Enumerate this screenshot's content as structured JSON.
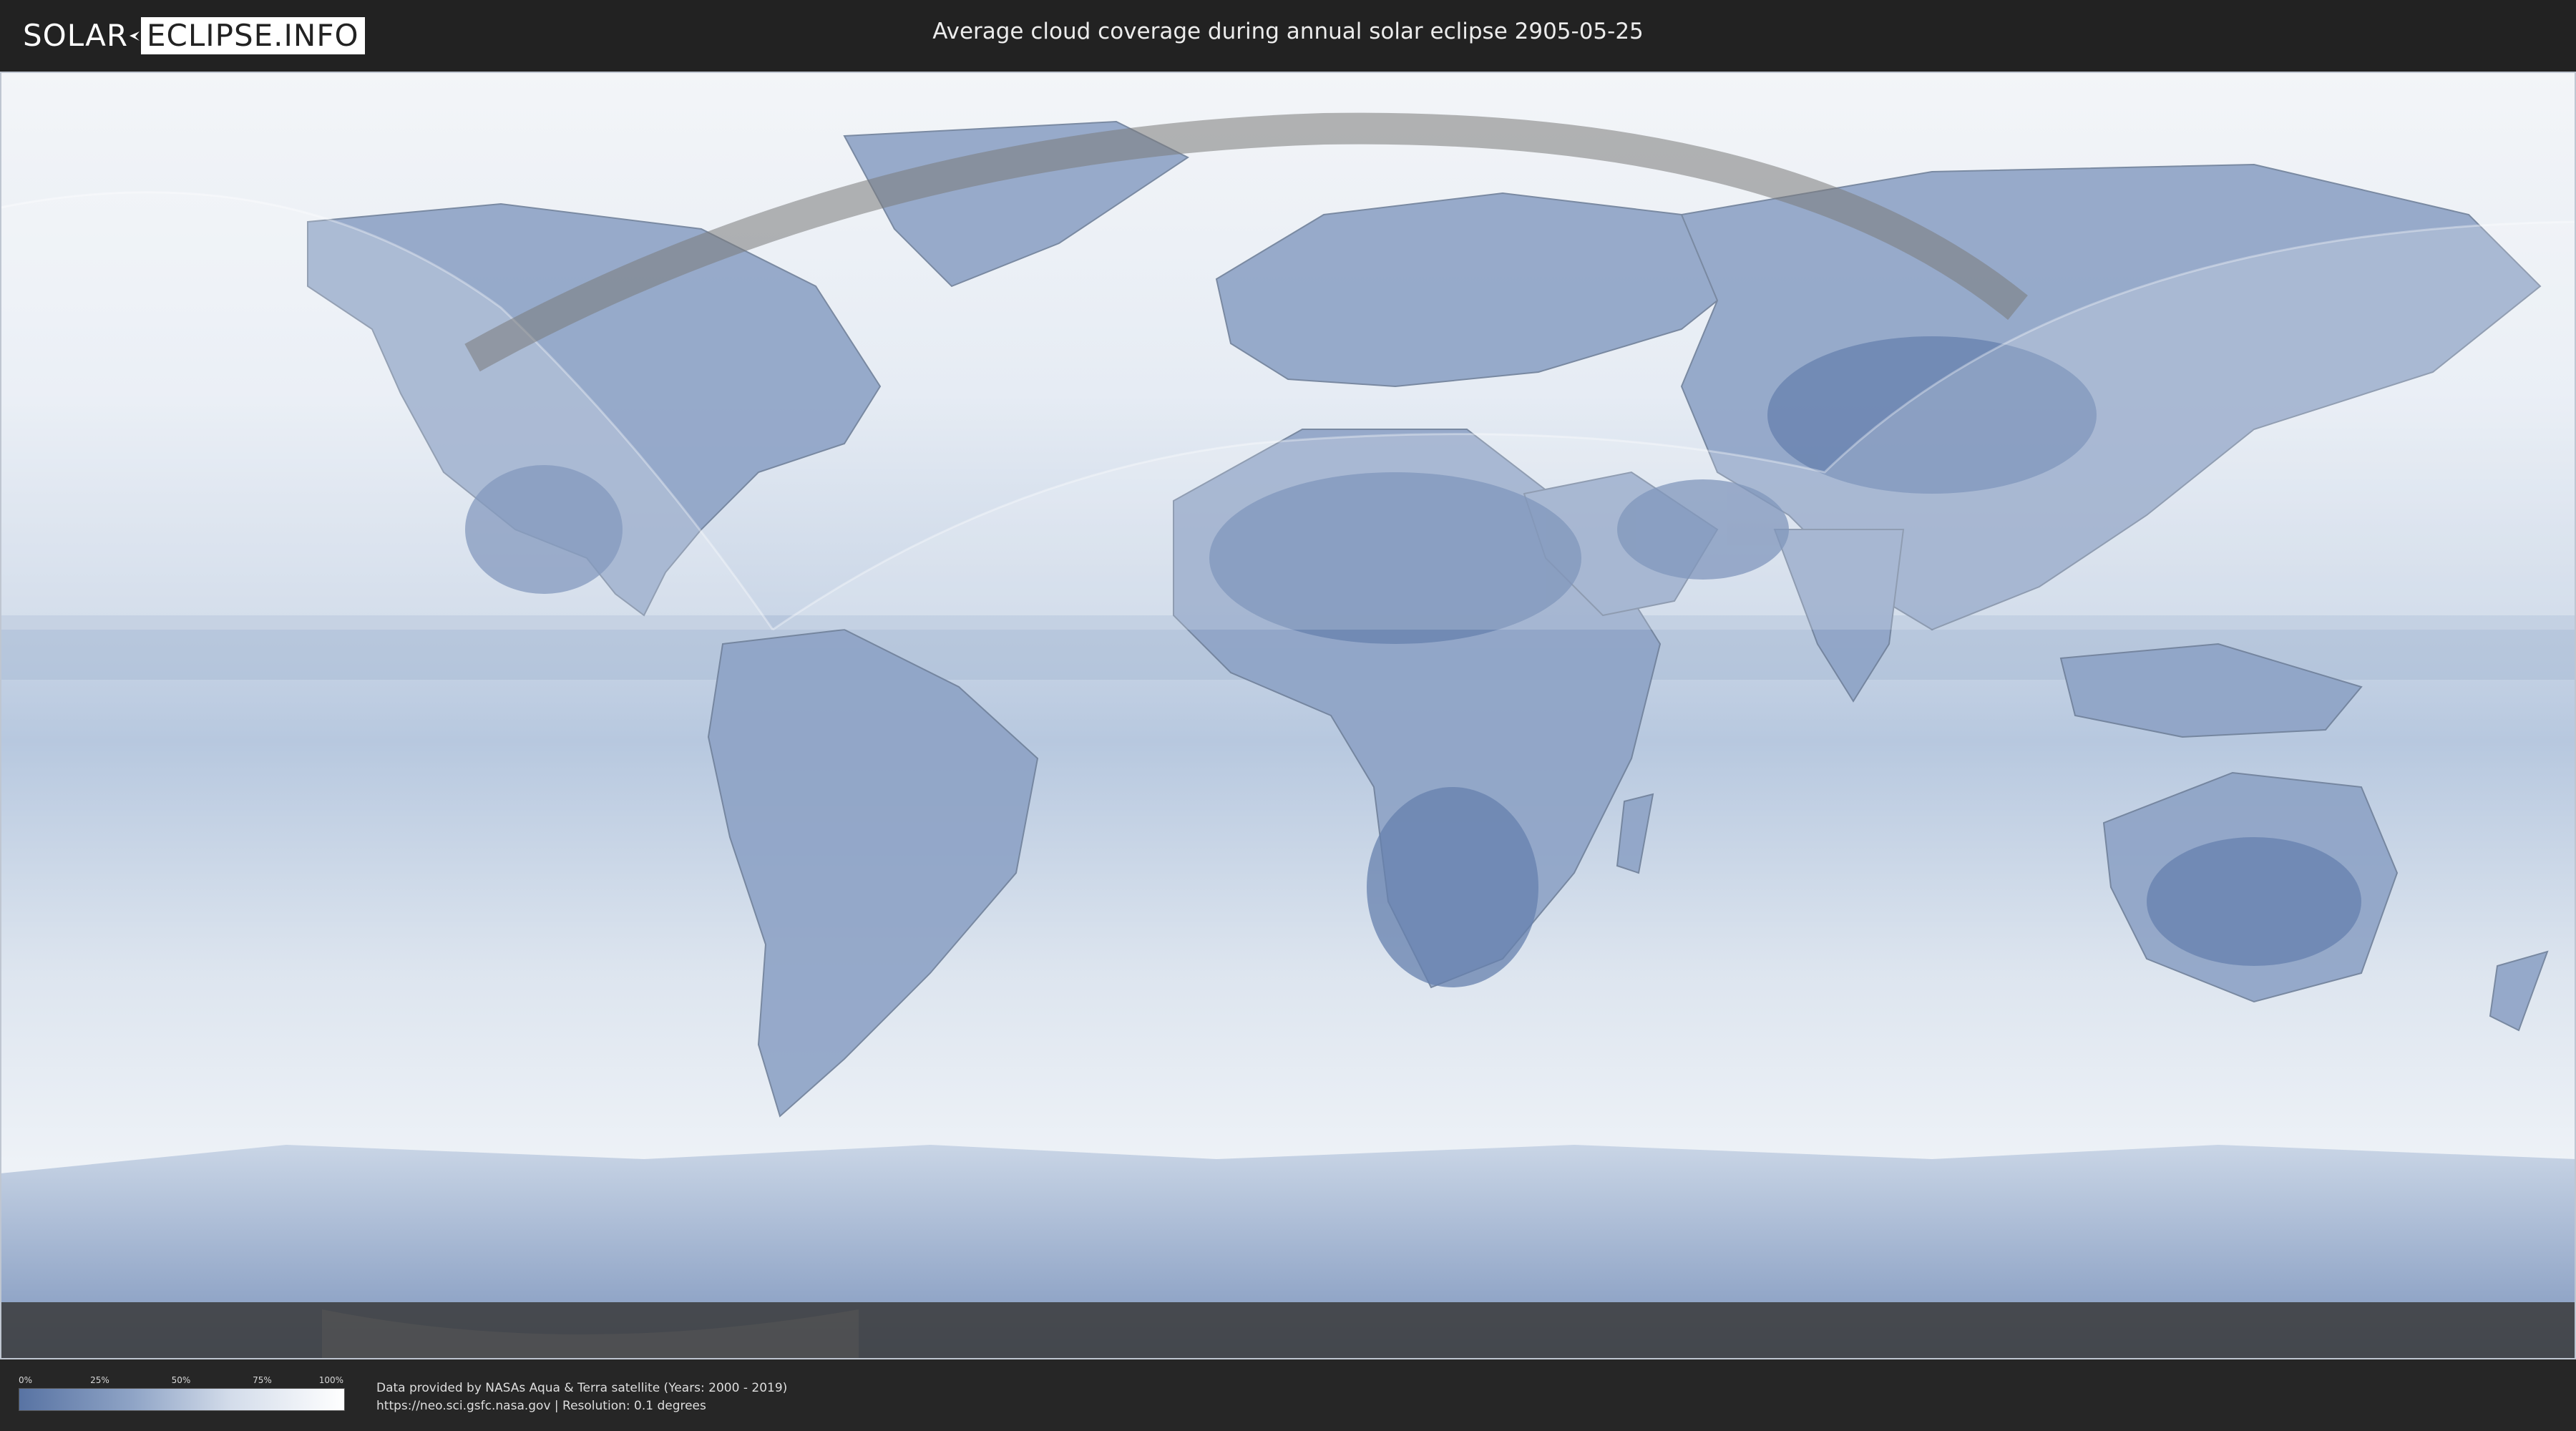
{
  "header": {
    "logo_left": "SOLAR",
    "logo_right": "ECLIPSE.INFO",
    "title": "Average cloud coverage during annual solar eclipse 2905-05-25"
  },
  "legend": {
    "ticks": [
      "0%",
      "25%",
      "50%",
      "75%",
      "100%"
    ],
    "colors": [
      "#5873a3",
      "#8fa4c6",
      "#d3dcea",
      "#ffffff"
    ]
  },
  "credits": {
    "line1": "Data provided by NASAs Aqua & Terra satellite (Years: 2000 - 2019)",
    "line2": "https://neo.sci.gsfc.nasa.gov | Resolution: 0.1 degrees"
  },
  "map": {
    "ocean_color": "#e9eef5",
    "land_color": "#6f89b5",
    "path_color": "#8a8a8a",
    "night_color": "#3a3a3a"
  }
}
